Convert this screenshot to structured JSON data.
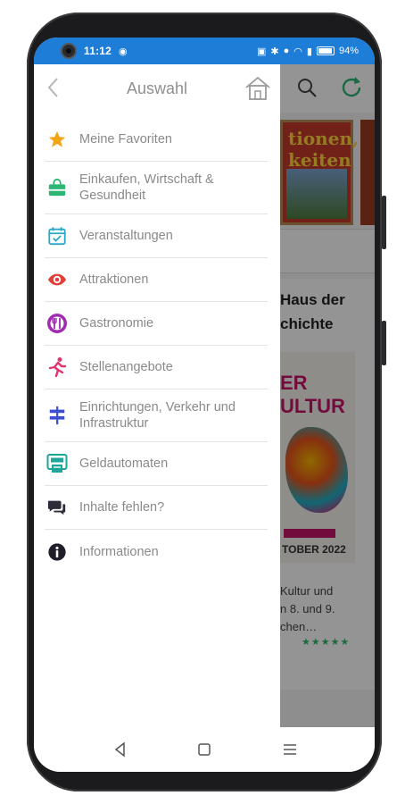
{
  "status_bar": {
    "time": "11:12",
    "battery": "94%",
    "color": "#1e7dd6"
  },
  "background_app": {
    "image_text": "tionen,\nkeiten",
    "heading": "Haus der\nchichte",
    "poster_text": "ER\nULTUR",
    "poster_date": "TOBER 2022",
    "description": "Kultur und\nn 8. und 9.\nchen…",
    "stars": "★★★★★"
  },
  "drawer": {
    "title": "Auswahl",
    "items": [
      {
        "label": "Meine Favoriten",
        "icon": "star-icon",
        "color": "#f2a516"
      },
      {
        "label": "Einkaufen, Wirtschaft &\nGesundheit",
        "icon": "shopping-bag-icon",
        "color": "#2bb673"
      },
      {
        "label": "Veranstaltungen",
        "icon": "calendar-check-icon",
        "color": "#2ba8c9"
      },
      {
        "label": "Attraktionen",
        "icon": "eye-icon",
        "color": "#e0403a"
      },
      {
        "label": "Gastronomie",
        "icon": "restaurant-icon",
        "color": "#a02bb0"
      },
      {
        "label": "Stellenangebote",
        "icon": "runner-icon",
        "color": "#e0356e"
      },
      {
        "label": "Einrichtungen, Verkehr und\nInfrastruktur",
        "icon": "signpost-icon",
        "color": "#3b4fd0"
      },
      {
        "label": "Geldautomaten",
        "icon": "atm-icon",
        "color": "#1fa69a"
      },
      {
        "label": "Inhalte fehlen?",
        "icon": "chat-bubbles-icon",
        "color": "#2b2b3a"
      },
      {
        "label": "Informationen",
        "icon": "info-icon",
        "color": "#1f1f2a"
      }
    ]
  }
}
